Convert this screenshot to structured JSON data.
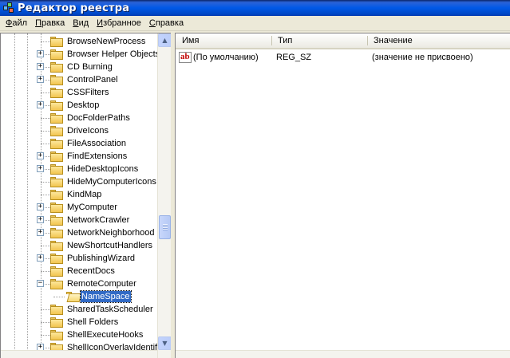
{
  "window": {
    "title": "Редактор реестра"
  },
  "menu": [
    "Файл",
    "Правка",
    "Вид",
    "Избранное",
    "Справка"
  ],
  "tree": {
    "items": [
      {
        "label": "BrowseNewProcess",
        "expandable": false
      },
      {
        "label": "Browser Helper Objects",
        "expandable": true
      },
      {
        "label": "CD Burning",
        "expandable": true
      },
      {
        "label": "ControlPanel",
        "expandable": true
      },
      {
        "label": "CSSFilters",
        "expandable": false
      },
      {
        "label": "Desktop",
        "expandable": true
      },
      {
        "label": "DocFolderPaths",
        "expandable": false
      },
      {
        "label": "DriveIcons",
        "expandable": false
      },
      {
        "label": "FileAssociation",
        "expandable": false
      },
      {
        "label": "FindExtensions",
        "expandable": true
      },
      {
        "label": "HideDesktopIcons",
        "expandable": true
      },
      {
        "label": "HideMyComputerIcons",
        "expandable": false
      },
      {
        "label": "KindMap",
        "expandable": false
      },
      {
        "label": "MyComputer",
        "expandable": true
      },
      {
        "label": "NetworkCrawler",
        "expandable": true
      },
      {
        "label": "NetworkNeighborhood",
        "expandable": true
      },
      {
        "label": "NewShortcutHandlers",
        "expandable": false
      },
      {
        "label": "PublishingWizard",
        "expandable": true
      },
      {
        "label": "RecentDocs",
        "expandable": false
      },
      {
        "label": "RemoteComputer",
        "expandable": "expanded"
      },
      {
        "label": "NameSpace",
        "expandable": false,
        "child": true,
        "selected": true
      },
      {
        "label": "SharedTaskScheduler",
        "expandable": false
      },
      {
        "label": "Shell Folders",
        "expandable": false
      },
      {
        "label": "ShellExecuteHooks",
        "expandable": false
      },
      {
        "label": "ShellIconOverlayIdentif",
        "expandable": true
      }
    ]
  },
  "list": {
    "columns": [
      "Имя",
      "Тип",
      "Значение"
    ],
    "rows": [
      {
        "icon": "ab",
        "name": "(По умолчанию)",
        "type": "REG_SZ",
        "value": "(значение не присвоено)"
      }
    ]
  },
  "colors": {
    "selection": "#316ac5",
    "titlebar": "#0058e6"
  }
}
